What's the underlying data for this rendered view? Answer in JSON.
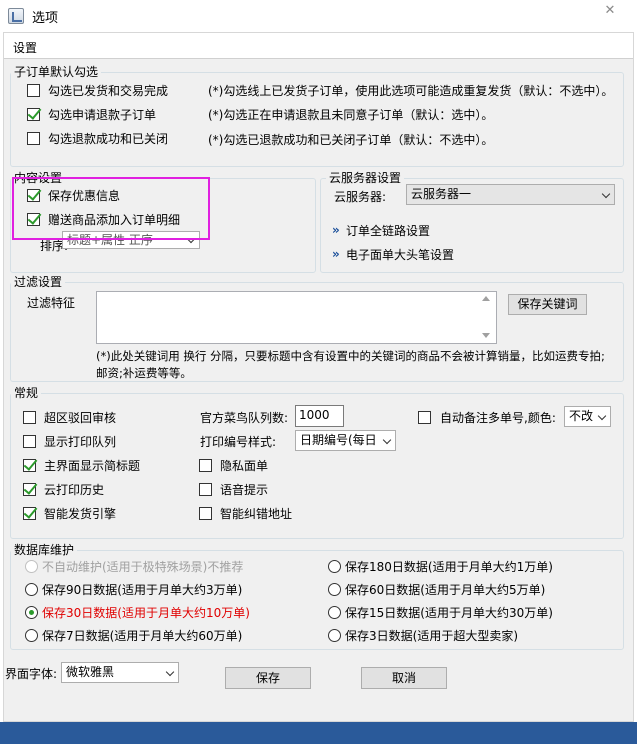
{
  "window": {
    "title": "选项",
    "close_glyph": "✕"
  },
  "tab": {
    "label": "设置"
  },
  "sub_order": {
    "title": "子订单默认勾选",
    "items": [
      {
        "label": "勾选已发货和交易完成",
        "checked": false,
        "note": "(*)勾选线上已发货子订单，使用此选项可能造成重复发货（默认：不选中）。"
      },
      {
        "label": "勾选申请退款子订单",
        "checked": true,
        "note": "(*)勾选正在申请退款且未同意子订单（默认：选中）。"
      },
      {
        "label": "勾选退款成功和已关闭",
        "checked": false,
        "note": "(*)勾选已退款成功和已关闭子订单（默认：不选中）。"
      }
    ]
  },
  "content": {
    "title": "内容设置",
    "items": [
      {
        "label": "保存优惠信息",
        "checked": true
      },
      {
        "label": "赠送商品添加入订单明细",
        "checked": true
      }
    ],
    "sort_label": "排序:",
    "sort_value": "标题+属性 正序"
  },
  "cloud": {
    "title": "云服务器设置",
    "server_label": "云服务器:",
    "server_value": "云服务器一",
    "link1": "订单全链路设置",
    "link2": "电子面单大头笔设置",
    "link_glyph": "»"
  },
  "filter": {
    "title": "过滤设置",
    "label": "过滤特征",
    "textarea_value": "",
    "save_button": "保存关键词",
    "note_line1": "(*)此处关键词用 换行 分隔，只要标题中含有设置中的关键词的商品不会被计算销量，比如运费专拍;",
    "note_line2": "邮资;补运费等等。"
  },
  "general": {
    "title": "常规",
    "col1": [
      {
        "label": "超区驳回审核",
        "checked": false
      },
      {
        "label": "显示打印队列",
        "checked": false
      },
      {
        "label": "主界面显示简标题",
        "checked": true
      },
      {
        "label": "云打印历史",
        "checked": true
      },
      {
        "label": "智能发货引擎",
        "checked": true
      }
    ],
    "cainiao_label": "官方菜鸟队列数:",
    "cainiao_value": "1000",
    "print_no_label": "打印编号样式:",
    "print_no_value": "日期编号(每日",
    "col2": [
      {
        "label": "隐私面单",
        "checked": false
      },
      {
        "label": "语音提示",
        "checked": false
      },
      {
        "label": "智能纠错地址",
        "checked": false
      }
    ],
    "auto_note_label": "自动备注多单号,颜色:",
    "auto_note_checked": false,
    "color_value": "不改"
  },
  "db": {
    "title": "数据库维护",
    "left": [
      {
        "label": "不自动维护(适用于极特殊场景)不推荐",
        "selected": false,
        "disabled": true
      },
      {
        "label": "保存90日数据(适用于月单大约3万单)",
        "selected": false
      },
      {
        "label": "保存30日数据(适用于月单大约10万单)",
        "selected": true
      },
      {
        "label": "保存7日数据(适用于月单大约60万单)",
        "selected": false
      }
    ],
    "right": [
      {
        "label": "保存180日数据(适用于月单大约1万单)",
        "selected": false
      },
      {
        "label": "保存60日数据(适用于月单大约5万单)",
        "selected": false
      },
      {
        "label": "保存15日数据(适用于月单大约30万单)",
        "selected": false
      },
      {
        "label": "保存3日数据(适用于超大型卖家)",
        "selected": false
      }
    ]
  },
  "footer": {
    "font_label": "界面字体:",
    "font_value": "微软雅黑",
    "save_button": "保存",
    "cancel_button": "取消"
  },
  "colors": {
    "highlight": "#e020e0",
    "check": "#2b9a2b",
    "selected_text": "#e00000",
    "taskbar": "#2a5a9a"
  }
}
